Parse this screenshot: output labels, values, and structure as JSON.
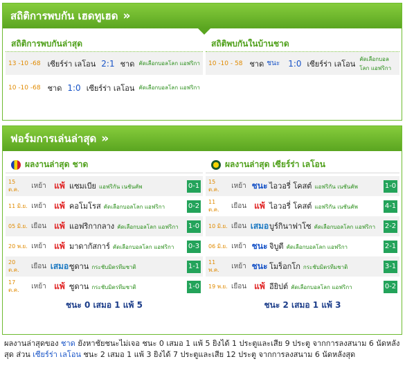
{
  "h2h": {
    "header": "สถิติการพบกัน เฮดทูเฮด",
    "chev": "»",
    "latest_title": "สถิติการพบกันล่าสุด",
    "home_title": "สถิติพบกันในบ้านชาด",
    "latest": [
      {
        "date": "13 -10 -68",
        "home": "เซียร์ร่า เลโอน",
        "score": "2:1",
        "away": "ชาด",
        "league": "คัดเลือกบอลโลก แอฟริกา"
      },
      {
        "date": "10 -10 -68",
        "home": "ชาด",
        "score": "1:0",
        "away": "เซียร์ร่า เลโอน",
        "league": "คัดเลือกบอลโลก แอฟริกา"
      }
    ],
    "home": [
      {
        "date": "10 -10 - 58",
        "home": "ชาด",
        "result": "ชนะ",
        "score": "1:0",
        "away": "เซียร์ร่า เลโอน",
        "league": "คัดเลือกบอลโลก แอฟริกา"
      }
    ]
  },
  "form": {
    "header": "ฟอร์มการเล่นล่าสุด",
    "chev": "»",
    "left": {
      "title": "ผลงานล่าสุด ชาด",
      "rows": [
        {
          "date": "15 ต.ค.",
          "ha": "เหย้า",
          "res": "แพ้",
          "cls": "lose",
          "opp": "แซมเบีย",
          "lg": "แอฟริกัน เนชันคัพ",
          "score": "0-1"
        },
        {
          "date": "11 มิ.ย.",
          "ha": "เหย้า",
          "res": "แพ้",
          "cls": "lose",
          "opp": "คอโมโรส",
          "lg": "คัดเลือกบอลโลก แอฟริกา",
          "score": "0-2"
        },
        {
          "date": "05 มิ.ย.",
          "ha": "เยือน",
          "res": "แพ้",
          "cls": "lose",
          "opp": "แอฟริกากลาง",
          "lg": "คัดเลือกบอลโลก แอฟริกา",
          "score": "1-0"
        },
        {
          "date": "20 พ.ย.",
          "ha": "เหย้า",
          "res": "แพ้",
          "cls": "lose",
          "opp": "มาดากัสการ์",
          "lg": "คัดเลือกบอลโลก แอฟริกา",
          "score": "0-3"
        },
        {
          "date": "20 ต.ค.",
          "ha": "เยือน",
          "res": "เสมอ",
          "cls": "draw",
          "opp": "ซูดาน",
          "lg": "กระชับมิตรทีมชาติ",
          "score": "1-1"
        },
        {
          "date": "17 ต.ค.",
          "ha": "เหย้า",
          "res": "แพ้",
          "cls": "lose",
          "opp": "ซูดาน",
          "lg": "กระชับมิตรทีมชาติ",
          "score": "1-0"
        }
      ],
      "total": "ชนะ 0 เสมอ 1 แพ้ 5"
    },
    "right": {
      "title": "ผลงานล่าสุด เซียร์ร่า เลโอน",
      "rows": [
        {
          "date": "15 ต.ค.",
          "ha": "เหย้า",
          "res": "ชนะ",
          "cls": "win",
          "opp": "ไอวอรี่ โคสต์",
          "lg": "แอฟริกัน เนชันคัพ",
          "score": "1-0"
        },
        {
          "date": "11 ต.ค.",
          "ha": "เยือน",
          "res": "แพ้",
          "cls": "lose",
          "opp": "ไอวอรี่ โคสต์",
          "lg": "แอฟริกัน เนชันคัพ",
          "score": "4-1"
        },
        {
          "date": "10 มิ.ย.",
          "ha": "เยือน",
          "res": "เสมอ",
          "cls": "draw",
          "opp": "บูร์กินาฟาโซ",
          "lg": "คัดเลือกบอลโลก แอฟริกา",
          "score": "2-2"
        },
        {
          "date": "06 มิ.ย.",
          "ha": "เหย้า",
          "res": "ชนะ",
          "cls": "win",
          "opp": "จิบูตี",
          "lg": "คัดเลือกบอลโลก แอฟริกา",
          "score": "2-1"
        },
        {
          "date": "11 พ.ค.",
          "ha": "เหย้า",
          "res": "ชนะ",
          "cls": "win",
          "opp": "โมร็อกโก",
          "lg": "กระชับมิตรทีมชาติ",
          "score": "3-1"
        },
        {
          "date": "19 พ.ย.",
          "ha": "เยือน",
          "res": "แพ้",
          "cls": "lose",
          "opp": "อียิปต์",
          "lg": "คัดเลือกบอลโลก แอฟริกา",
          "score": "0-2"
        }
      ],
      "total": "ชนะ 2 เสมอ 1 แพ้ 3"
    }
  },
  "summary": {
    "p1": "ผลงานล่าสุดของ ",
    "team1": "ชาด",
    "p2": " ยังหาชัยชนะไม่เจอ ชนะ 0 เสมอ 1 แพ้ 5 ยิงได้ 1 ประตูและเสีย 9 ประตู จากการลงสนาม 6 นัดหลังสุด ส่วน ",
    "team2": "เซียร์ร่า เลโอน",
    "p3": " ชนะ 2 เสมอ 1 แพ้ 3 ยิงได้ 7 ประตูและเสีย 12 ประตู จากการลงสนาม 6 นัดหลังสุด"
  },
  "colors": {
    "green": "#6dba2f",
    "lose": "#e02020",
    "draw": "#1a78c2",
    "win": "#1753c7",
    "score_bg": "#23a35a"
  }
}
